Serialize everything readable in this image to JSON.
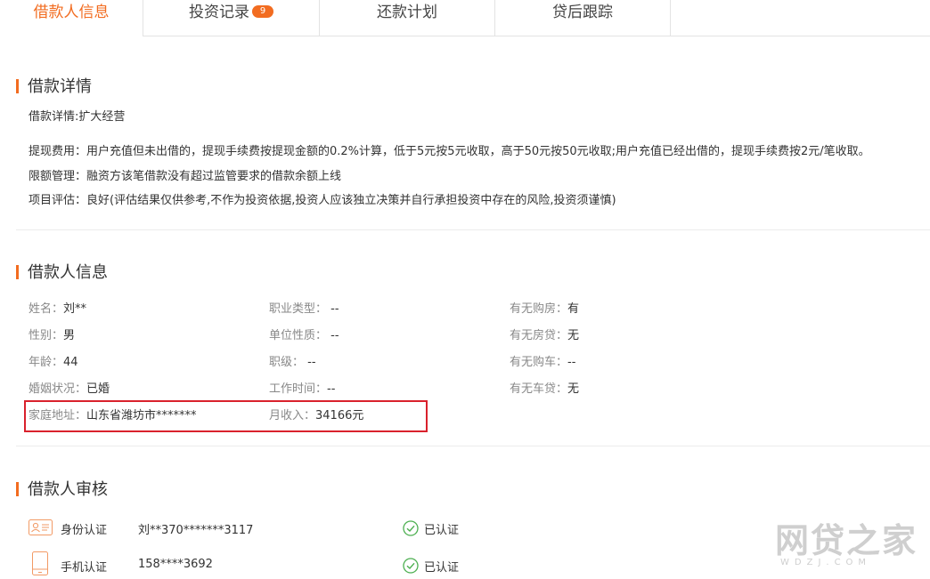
{
  "tabs": [
    {
      "label": "借款人信息",
      "active": true
    },
    {
      "label": "投资记录",
      "badge": "9"
    },
    {
      "label": "还款计划"
    },
    {
      "label": "贷后跟踪"
    }
  ],
  "loan_details": {
    "title": "借款详情",
    "purpose": "借款详情:扩大经营",
    "fee": "提现费用：用户充值但未出借的，提现手续费按提现金额的0.2%计算，低于5元按5元收取，高于50元按50元收取;用户充值已经出借的，提现手续费按2元/笔收取。",
    "limit": "限额管理：融资方该笔借款没有超过监管要求的借款余额上线",
    "evaluation": "项目评估：良好(评估结果仅供参考,不作为投资依据,投资人应该独立决策并自行承担投资中存在的风险,投资须谨慎)"
  },
  "borrower_info": {
    "title": "借款人信息",
    "rows": [
      [
        {
          "label": "姓名：",
          "value": "刘**"
        },
        {
          "label": "职业类型：",
          "value": " --"
        },
        {
          "label": "有无购房：",
          "value": "有"
        }
      ],
      [
        {
          "label": "性别：",
          "value": "男"
        },
        {
          "label": "单位性质：",
          "value": " --"
        },
        {
          "label": "有无房贷：",
          "value": "无"
        }
      ],
      [
        {
          "label": "年龄：",
          "value": "44"
        },
        {
          "label": "职级：",
          "value": " --"
        },
        {
          "label": "有无购车：",
          "value": "--"
        }
      ],
      [
        {
          "label": "婚姻状况：",
          "value": "已婚"
        },
        {
          "label": "工作时间：",
          "value": "--"
        },
        {
          "label": "有无车贷：",
          "value": "无"
        }
      ],
      [
        {
          "label": "家庭地址：",
          "value": "山东省潍坊市*******"
        },
        {
          "label": "月收入：",
          "value": "34166元"
        }
      ]
    ]
  },
  "audit": {
    "title": "借款人审核",
    "items": [
      {
        "icon": "id-card-icon",
        "name": "身份认证",
        "value": "刘**370*******3117",
        "status": "已认证"
      },
      {
        "icon": "mobile-phone-icon",
        "name": "手机认证",
        "value": "158****3692",
        "status": "已认证"
      }
    ]
  },
  "watermark": {
    "main": "网贷之家",
    "sub": "WDZJ.COM"
  },
  "colors": {
    "accent": "#f26c20",
    "highlight": "#d9212c",
    "success": "#4caf50"
  }
}
